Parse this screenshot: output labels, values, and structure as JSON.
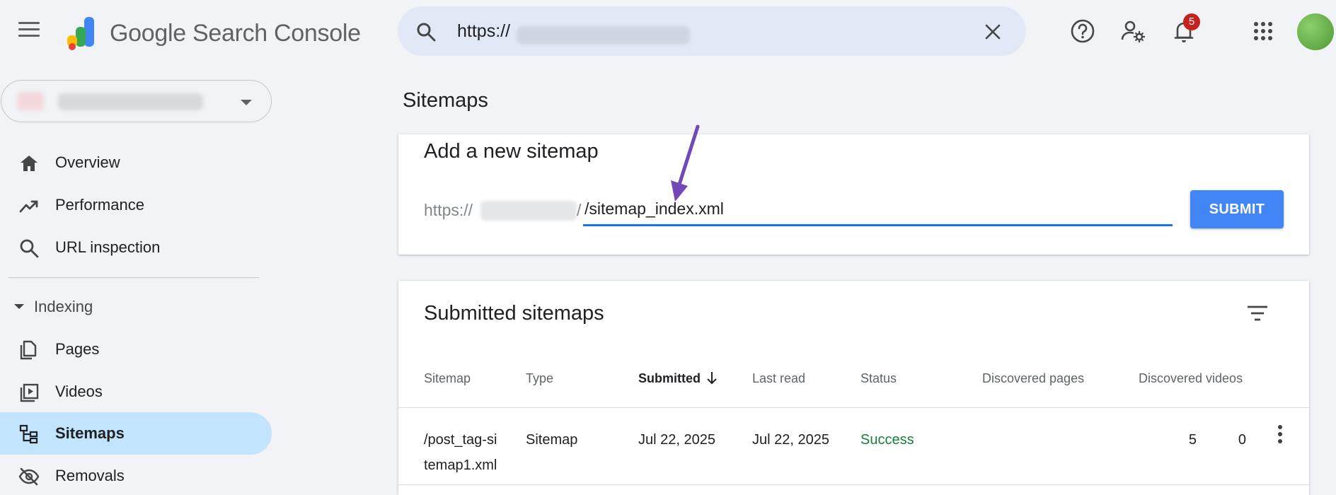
{
  "header": {
    "product_name": "Google Search Console",
    "search_value": "https://",
    "notification_count": "5"
  },
  "sidebar": {
    "items": [
      {
        "label": "Overview",
        "icon": "home-icon"
      },
      {
        "label": "Performance",
        "icon": "trending-up-icon"
      },
      {
        "label": "URL inspection",
        "icon": "search-icon"
      }
    ],
    "section_label": "Indexing",
    "indexing_items": [
      {
        "label": "Pages",
        "icon": "pages-icon"
      },
      {
        "label": "Videos",
        "icon": "video-icon"
      },
      {
        "label": "Sitemaps",
        "icon": "sitemap-icon",
        "active": true
      },
      {
        "label": "Removals",
        "icon": "eye-off-icon"
      }
    ]
  },
  "main": {
    "page_title": "Sitemaps",
    "add_card": {
      "title": "Add a new sitemap",
      "prefix": "https://",
      "slash": "/",
      "input_value": "/sitemap_index.xml",
      "submit_label": "SUBMIT"
    },
    "submitted_card": {
      "title": "Submitted sitemaps",
      "columns": [
        "Sitemap",
        "Type",
        "Submitted",
        "Last read",
        "Status",
        "Discovered pages",
        "Discovered videos"
      ],
      "rows": [
        {
          "sitemap_line1": "/post_tag-si",
          "sitemap_line2": "temap1.xml",
          "type": "Sitemap",
          "submitted": "Jul 22, 2025",
          "last_read": "Jul 22, 2025",
          "status": "Success",
          "discovered_pages": "5",
          "discovered_videos": "0"
        }
      ]
    }
  },
  "colors": {
    "accent": "#1a73e8",
    "submit_button": "#4285f4",
    "active_nav": "#c2e4fd",
    "success": "#188038",
    "annotation_arrow": "#7248b9"
  }
}
